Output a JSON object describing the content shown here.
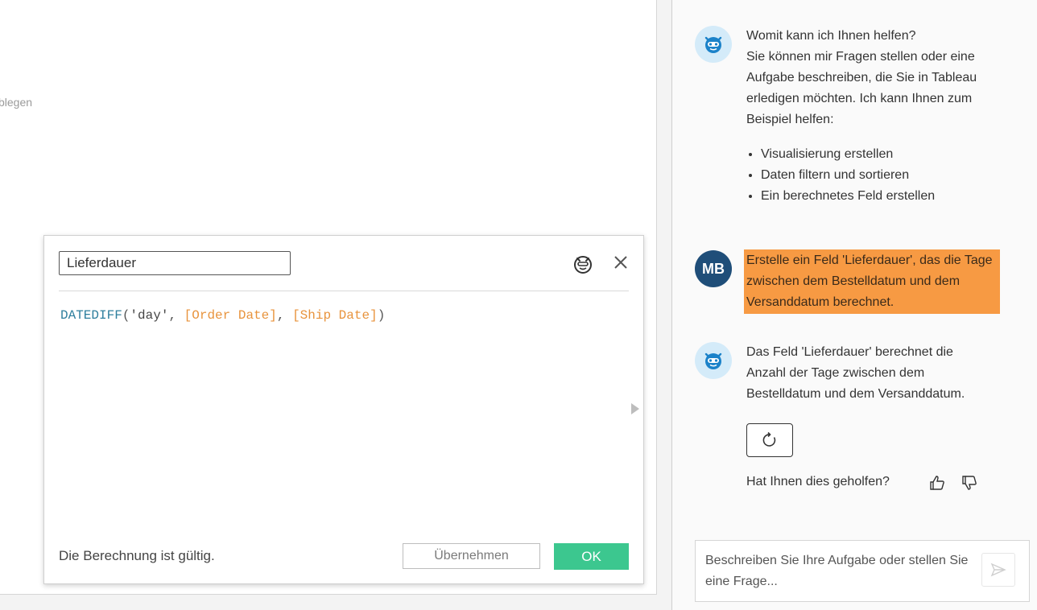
{
  "canvas": {
    "drop_hint": "blegen"
  },
  "calc_dialog": {
    "name_value": "Lieferdauer",
    "formula": {
      "fn": "DATEDIFF",
      "open": "(",
      "arg1": "'day'",
      "sep1": ", ",
      "field1": "[Order Date]",
      "sep2": ", ",
      "field2": "[Ship Date]",
      "close": ")"
    },
    "status": "Die Berechnung ist gültig.",
    "apply_label": "Übernehmen",
    "ok_label": "OK",
    "close_icon": "×"
  },
  "chat": {
    "intro": {
      "line1": "Womit kann ich Ihnen helfen?",
      "line2": "Sie können mir Fragen stellen oder eine",
      "line3": "Aufgabe beschreiben, die Sie in Tableau",
      "line4": "erledigen möchten. Ich kann Ihnen zum",
      "line5": "Beispiel helfen:"
    },
    "suggestions": [
      "Visualisierung erstellen",
      "Daten filtern und sortieren",
      "Ein berechnetes Feld erstellen"
    ],
    "user_initials": "MB",
    "user_message": "Erstelle ein Feld 'Lieferdauer', das die Tage zwischen dem Bestelldatum und dem Versanddatum berechnet.",
    "reply": {
      "line1": "Das Feld 'Lieferdauer' berechnet die",
      "line2": "Anzahl der Tage zwischen dem",
      "line3": "Bestelldatum und dem Versanddatum."
    },
    "feedback_question": "Hat Ihnen dies geholfen?",
    "input_placeholder": "Beschreiben Sie Ihre Aufgabe oder stellen Sie eine Frage...",
    "accent_color": "#f79a43",
    "ok_color": "#3cc78f"
  }
}
